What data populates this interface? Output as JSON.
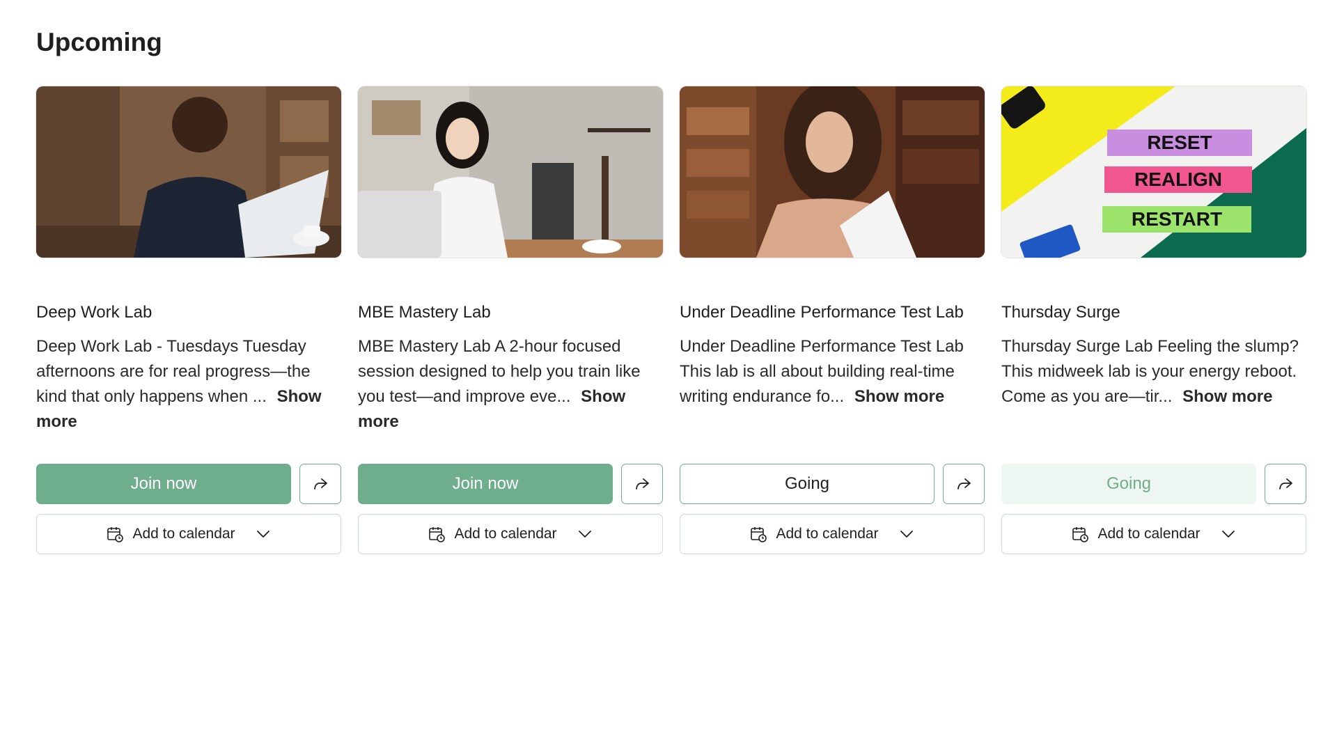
{
  "section": {
    "title": "Upcoming"
  },
  "colors": {
    "accent": "#6fae8c",
    "accent_light": "#eef6f1"
  },
  "cards": [
    {
      "title": "Deep Work Lab",
      "description": "Deep Work Lab - Tuesdays Tuesday afternoons are for real progress—the kind that only happens when ...",
      "show_more": "Show more",
      "primary_label": "Join now",
      "primary_state": "join",
      "calendar_label": "Add to calendar",
      "image_icon": "photo-man-laptop"
    },
    {
      "title": "MBE Mastery Lab",
      "description": "MBE Mastery Lab A 2-hour focused session designed to help you train like you test—and improve eve...",
      "show_more": "Show more",
      "primary_label": "Join now",
      "primary_state": "join",
      "calendar_label": "Add to calendar",
      "image_icon": "photo-woman-thinking"
    },
    {
      "title": "Under Deadline Performance Test Lab",
      "description": "Under Deadline Performance Test Lab This lab is all about building real-time writing endurance fo...",
      "show_more": "Show more",
      "primary_label": "Going",
      "primary_state": "going",
      "calendar_label": "Add to calendar",
      "image_icon": "photo-woman-reading"
    },
    {
      "title": "Thursday Surge",
      "description": "Thursday Surge Lab Feeling the slump? This midweek lab is your energy reboot. Come as you are—tir...",
      "show_more": "Show more",
      "primary_label": "Going",
      "primary_state": "going-muted",
      "calendar_label": "Add to calendar",
      "image_icon": "photo-sticky-notes",
      "image_text": [
        "RESET",
        "REALIGN",
        "RESTART"
      ]
    }
  ]
}
